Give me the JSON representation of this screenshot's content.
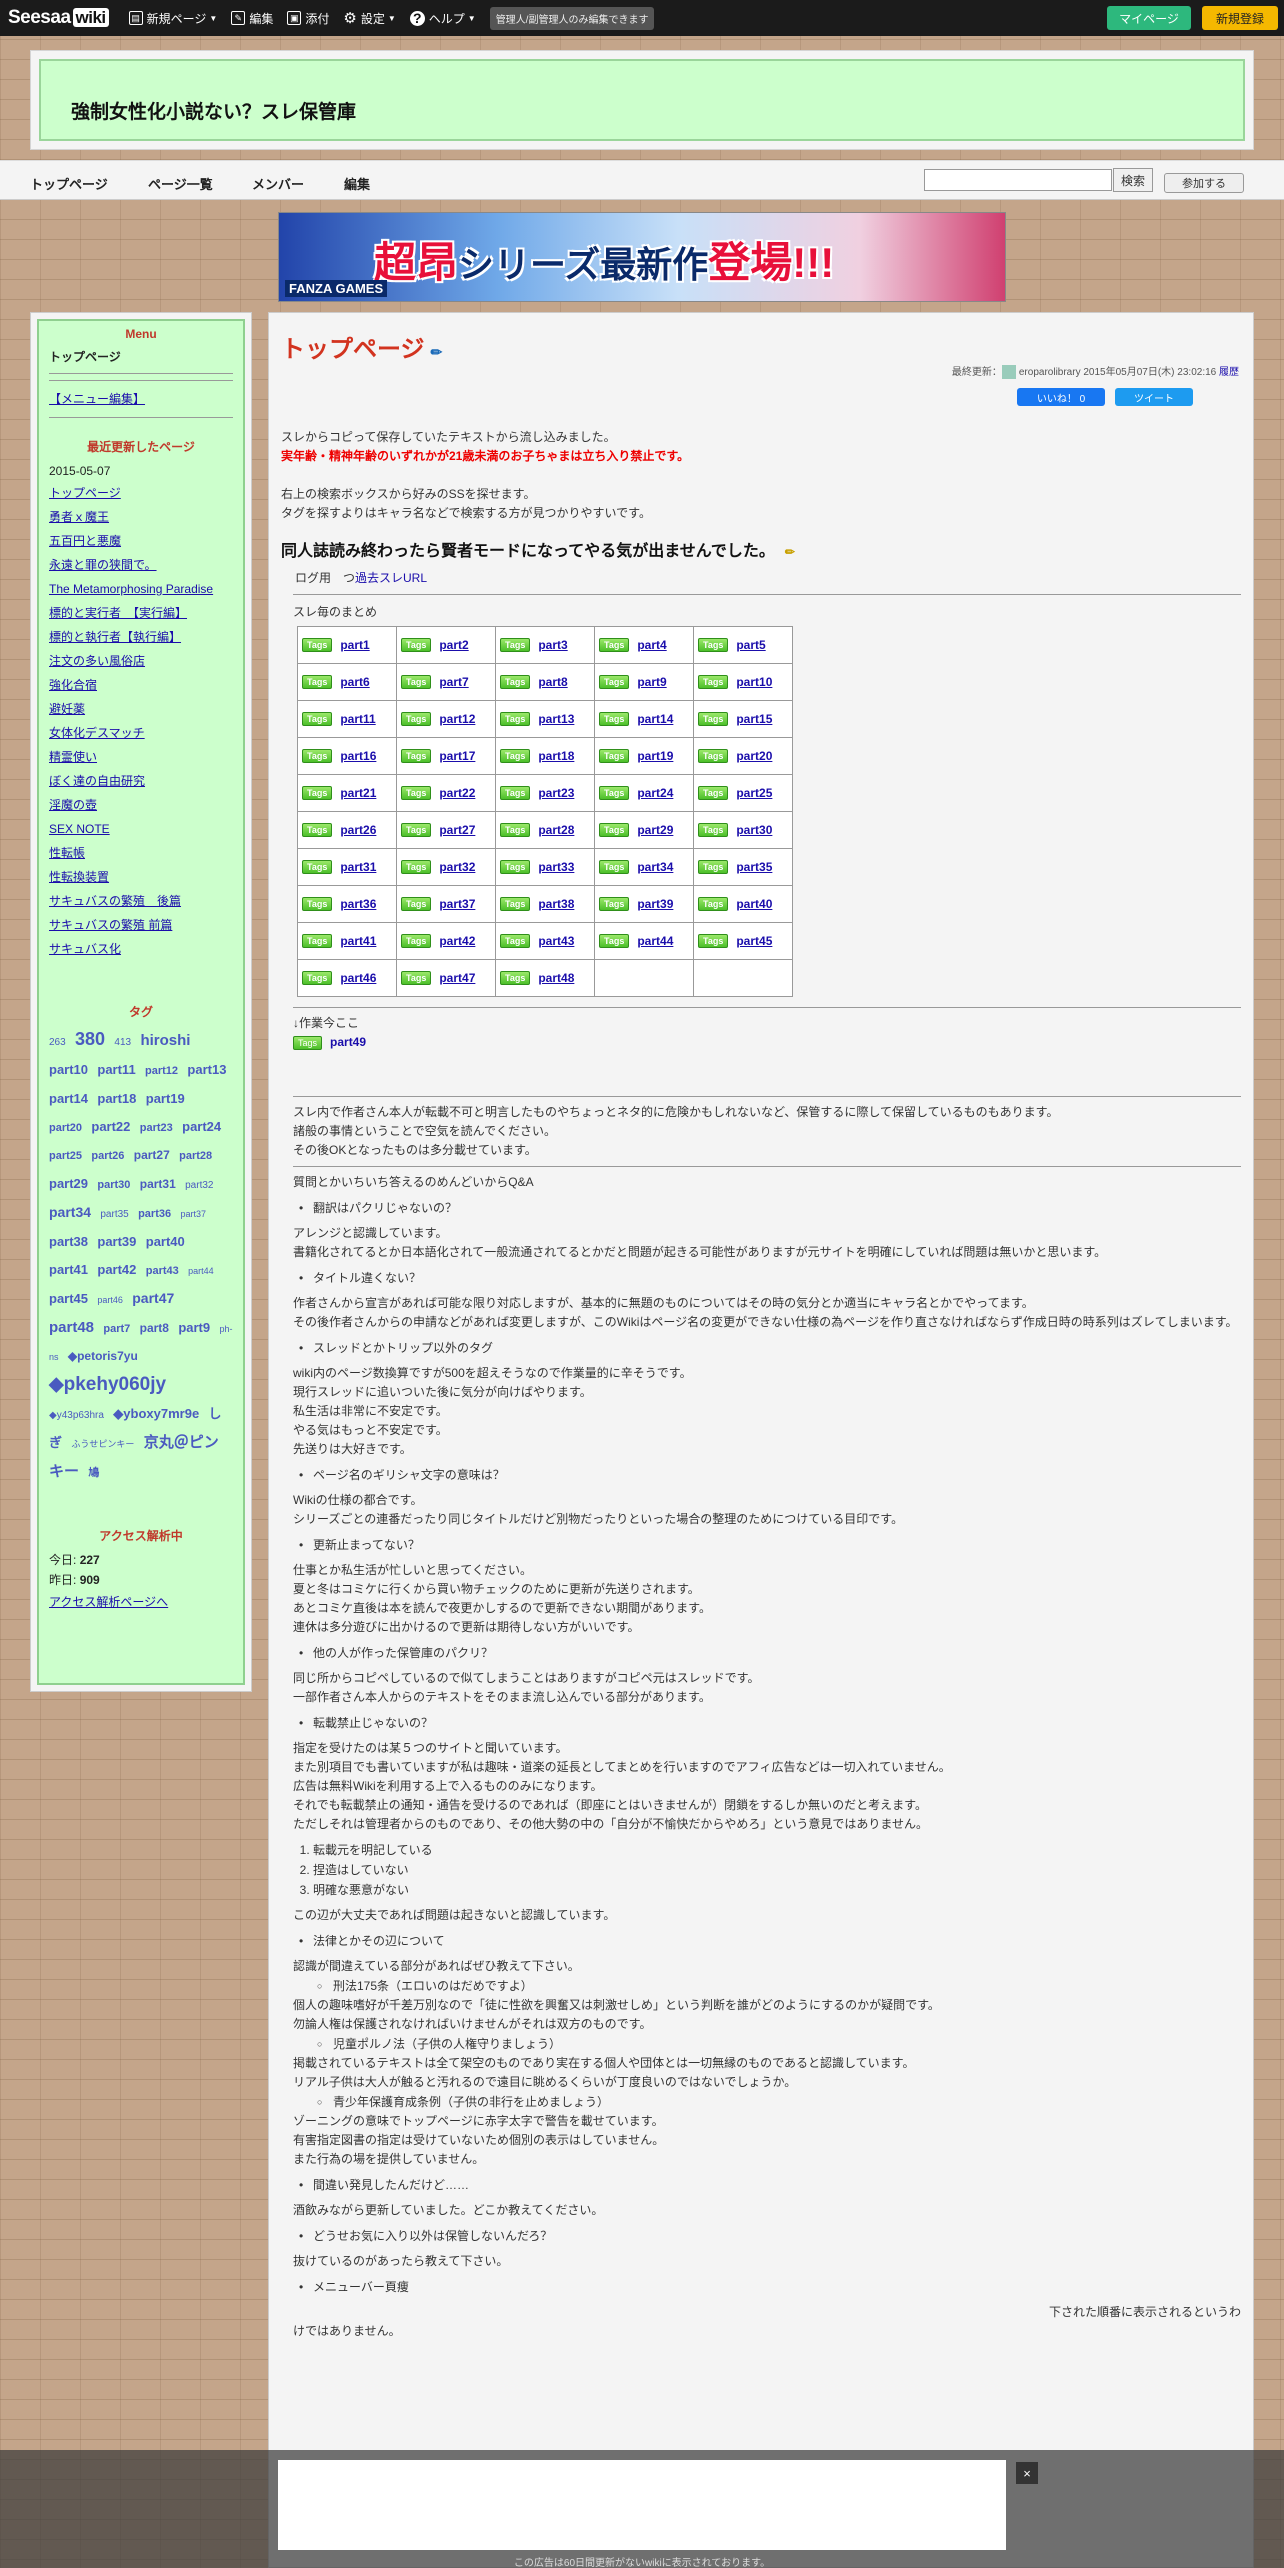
{
  "topbar": {
    "logo": "Seesaa",
    "logo_wiki": "wiki",
    "new_page": "新規ページ",
    "edit": "編集",
    "attach": "添付",
    "settings": "設定",
    "help": "ヘルプ",
    "note": "管理人/副管理人のみ編集できます",
    "mypage": "マイページ",
    "signup": "新規登録"
  },
  "header": {
    "title": "強制女性化小説ない？スレ保管庫"
  },
  "nav": {
    "items": [
      "トップページ",
      "ページ一覧",
      "メンバー",
      "編集"
    ],
    "search_btn": "検索",
    "join": "参加する"
  },
  "banner": {
    "text1": "超昂",
    "text2": "シリーズ最新作",
    "text3": "登場!!!",
    "logo": "FANZA GAMES"
  },
  "sidebar": {
    "menu_title": "Menu",
    "menu_top": "トップページ",
    "menu_edit": "【メニュー編集】",
    "recent_title": "最近更新したページ",
    "recent_date": "2015-05-07",
    "recent": [
      "トップページ",
      "勇者ｘ魔王",
      "五百円と悪魔",
      "永遠と罪の狭間で。",
      "The Metamorphosing Paradise",
      "標的と実行者　【実行編】",
      "標的と執行者【執行編】",
      "注文の多い風俗店",
      "強化合宿",
      "避妊薬",
      "女体化デスマッチ",
      "精霊使い",
      "ぼく達の自由研究",
      "淫魔の壺",
      "SEX NOTE",
      "性転帳",
      "性転換装置",
      "サキュバスの繁殖　後篇",
      "サキュバスの繁殖 前篇",
      "サキュバス化"
    ],
    "tag_title": "タグ",
    "tags": [
      "263",
      "380",
      "413",
      "hiroshi",
      "part10",
      "part11",
      "part12",
      "part13",
      "part14",
      "part18",
      "part19",
      "part20",
      "part22",
      "part23",
      "part24",
      "part25",
      "part26",
      "part27",
      "part28",
      "part29",
      "part30",
      "part31",
      "part32",
      "part34",
      "part35",
      "part36",
      "part37",
      "part38",
      "part39",
      "part40",
      "part41",
      "part42",
      "part43",
      "part44",
      "part45",
      "part46",
      "part47",
      "part48",
      "part7",
      "part8",
      "part9",
      "ph-ns",
      "◆petoris7yu",
      "◆pkehy060jy",
      "◆y43p63hra",
      "◆yboxy7mr9e",
      "しぎ",
      "ふうせピンキー",
      "京丸＠ピンキー",
      "鳩"
    ],
    "access_title": "アクセス解析中",
    "today_label": "今日:",
    "today": "227",
    "yesterday_label": "昨日:",
    "yesterday": "909",
    "access_link": "アクセス解析ページへ"
  },
  "main": {
    "title": "トップページ",
    "meta_label": "最終更新：",
    "meta_user": "eroparolibrary",
    "meta_date": "2015年05月07日(木) 23:02:16",
    "history": "履歴",
    "like": "いいね！ 0",
    "tweet": "ツイート",
    "intro1": "スレからコピって保存していたテキストから流し込みました。",
    "intro_red": "実年齢・精神年齢のいずれかが21歳未満のお子ちゃまは立ち入り禁止です。",
    "intro2": "右上の検索ボックスから好みのSSを探せます。",
    "intro3": "タグを探すよりはキャラ名などで検索する方が見つかりやすいです。",
    "h2": "同人誌読み終わったら賢者モードになってやる気が出ませんでした。",
    "log_label": "ログ用　つ",
    "log_link": "過去スレURL",
    "summary": "スレ毎のまとめ",
    "tag_label": "Tags",
    "parts": [
      "part1",
      "part2",
      "part3",
      "part4",
      "part5",
      "part6",
      "part7",
      "part8",
      "part9",
      "part10",
      "part11",
      "part12",
      "part13",
      "part14",
      "part15",
      "part16",
      "part17",
      "part18",
      "part19",
      "part20",
      "part21",
      "part22",
      "part23",
      "part24",
      "part25",
      "part26",
      "part27",
      "part28",
      "part29",
      "part30",
      "part31",
      "part32",
      "part33",
      "part34",
      "part35",
      "part36",
      "part37",
      "part38",
      "part39",
      "part40",
      "part41",
      "part42",
      "part43",
      "part44",
      "part45",
      "part46",
      "part47",
      "part48"
    ],
    "wip": "↓作業今ここ",
    "wip_part": "part49",
    "notice1": "スレ内で作者さん本人が転載不可と明言したものやちょっとネタ的に危険かもしれないなど、保管するに際して保留しているものもあります。",
    "notice2": "諸般の事情ということで空気を読んでください。",
    "notice3": "その後OKとなったものは多分載せています。",
    "qa": "質問とかいちいち答えるのめんどいからQ&A",
    "q1": "翻訳はパクリじゃないの？",
    "a1": [
      "アレンジと認識しています。",
      "書籍化されてるとか日本語化されて一般流通されてるとかだと問題が起きる可能性がありますが元サイトを明確にしていれば問題は無いかと思います。"
    ],
    "q2": "タイトル違くない？",
    "a2": [
      "作者さんから宣言があれば可能な限り対応しますが、基本的に無題のものについてはその時の気分とか適当にキャラ名とかでやってます。",
      "その後作者さんからの申請などがあれば変更しますが、このWikiはページ名の変更ができない仕様の為ページを作り直さなければならず作成日時の時系列はズレてしまいます。"
    ],
    "q3": "スレッドとかトリップ以外のタグ",
    "a3": [
      "wiki内のページ数換算ですが500を超えそうなので作業量的に辛そうです。",
      "現行スレッドに追いついた後に気分が向けばやります。",
      "私生活は非常に不安定です。",
      "やる気はもっと不安定です。",
      "先送りは大好きです。"
    ],
    "q4": "ページ名のギリシャ文字の意味は？",
    "a4": [
      "Wikiの仕様の都合です。",
      "シリーズごとの連番だったり同じタイトルだけど別物だったりといった場合の整理のためにつけている目印です。"
    ],
    "q5": "更新止まってない？",
    "a5": [
      "仕事とか私生活が忙しいと思ってください。",
      "夏と冬はコミケに行くから買い物チェックのために更新が先送りされます。",
      "あとコミケ直後は本を読んで夜更かしするので更新できない期間があります。",
      "連休は多分遊びに出かけるので更新は期待しない方がいいです。"
    ],
    "q6": "他の人が作った保管庫のパクリ？",
    "a6": [
      "同じ所からコピペしているので似てしまうことはありますがコピペ元はスレッドです。",
      "一部作者さん本人からのテキストをそのまま流し込んでいる部分があります。"
    ],
    "q7": "転載禁止じゃないの？",
    "a7": [
      "指定を受けたのは某５つのサイトと聞いています。",
      "また別項目でも書いていますが私は趣味・道楽の延長としてまとめを行いますのでアフィ広告などは一切入れていません。",
      "広告は無料Wikiを利用する上で入るもののみになります。",
      "それでも転載禁止の通知・通告を受けるのであれば（即座にとはいきませんが）閉鎖をするしか無いのだと考えます。",
      "ただしそれは管理者からのものであり、その他大勢の中の「自分が不愉快だからやめろ」という意見ではありません。"
    ],
    "ol": [
      "転載元を明記している",
      "捏造はしていない",
      "明確な悪意がない"
    ],
    "ol_after": "この辺が大丈夫であれば問題は起きないと認識しています。",
    "q8": "法律とかその辺について",
    "a8": "認識が間違えている部分があればぜひ教えて下さい。",
    "law1": "刑法175条（エロいのはだめですよ）",
    "law1_a": [
      "個人の趣味嗜好が千差万別なので「徒に性欲を興奮又は刺激せしめ」という判断を誰がどのようにするのかが疑問です。",
      "勿論人権は保護されなければいけませんがそれは双方のものです。"
    ],
    "law2": "児童ポルノ法（子供の人権守りましょう）",
    "law2_a": [
      "掲載されているテキストは全て架空のものであり実在する個人や団体とは一切無縁のものであると認識しています。",
      "リアル子供は大人が触ると汚れるので遠目に眺めるくらいが丁度良いのではないでしょうか。"
    ],
    "law3": "青少年保護育成条例（子供の非行を止めましょう）",
    "law3_a": [
      "ゾーニングの意味でトップページに赤字太字で警告を載せています。",
      "有害指定図書の指定は受けていないため個別の表示はしていません。",
      "また行為の場を提供していません。"
    ],
    "q9": "間違い発見したんだけど……",
    "a9": "酒飲みながら更新していました。どこか教えてください。",
    "q10": "どうせお気に入り以外は保管しないんだろ？",
    "a10": "抜けているのがあったら教えて下さい。",
    "q11": "メニューバー頁痩",
    "cut": "下された順番に表示されるというわ",
    "cut2": "けではありません。"
  },
  "ad": {
    "close": "×",
    "note": "この広告は60日間更新がないwikiに表示されております。"
  }
}
